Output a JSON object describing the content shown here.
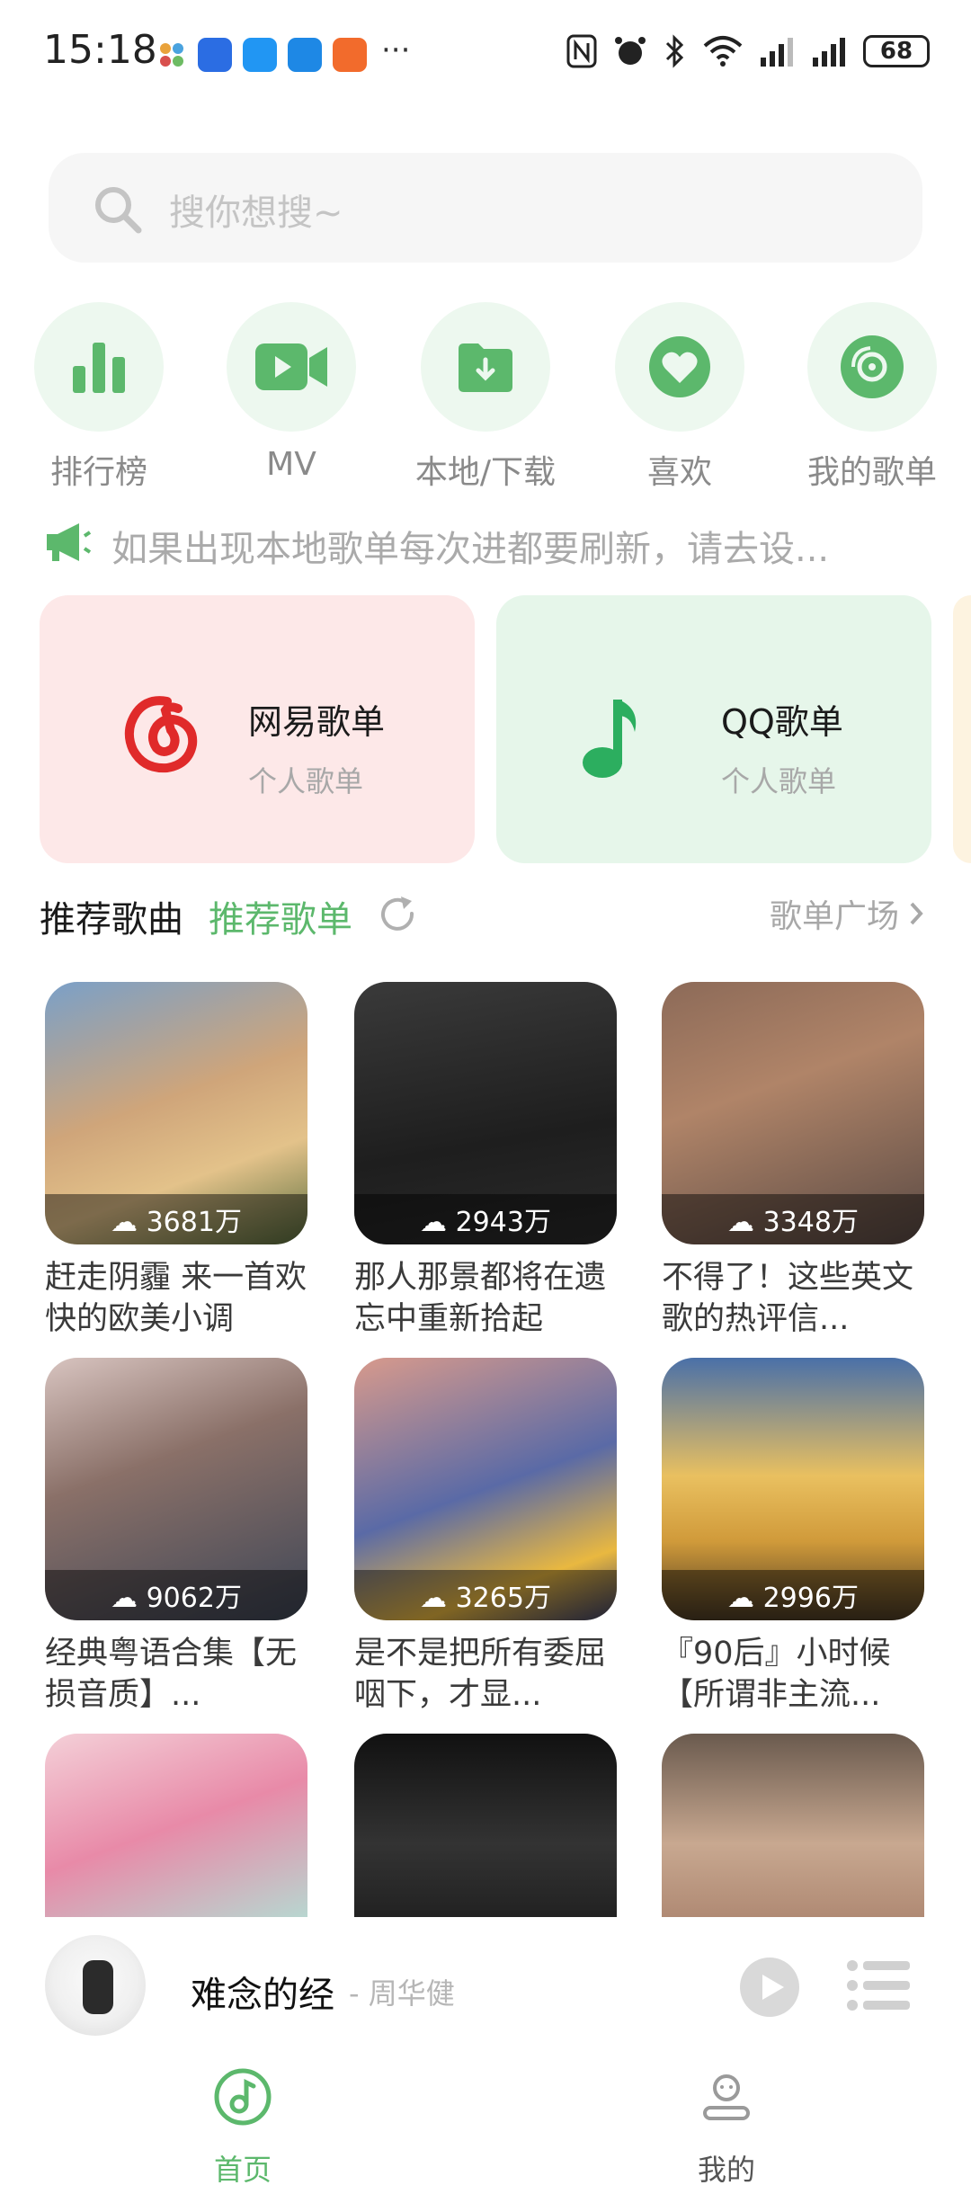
{
  "status_bar": {
    "time": "15:18",
    "battery": "68",
    "more": "···"
  },
  "search": {
    "placeholder": "搜你想搜~"
  },
  "categories": [
    {
      "label": "排行榜",
      "icon": "bar-chart-icon"
    },
    {
      "label": "MV",
      "icon": "video-camera-icon"
    },
    {
      "label": "本地/下载",
      "icon": "folder-download-icon"
    },
    {
      "label": "喜欢",
      "icon": "heart-icon"
    },
    {
      "label": "我的歌单",
      "icon": "disc-icon"
    }
  ],
  "notice": {
    "text": "如果出现本地歌单每次进都要刷新，请去设..."
  },
  "import_cards": [
    {
      "title": "网易歌单",
      "subtitle": "个人歌单",
      "color": "#fde8e8",
      "icon": "netease-cloud-music-icon"
    },
    {
      "title": "QQ歌单",
      "subtitle": "个人歌单",
      "color": "#e6f6ea",
      "icon": "qq-music-note-icon"
    }
  ],
  "section": {
    "tab_songs": "推荐歌曲",
    "tab_playlists": "推荐歌单",
    "plaza": "歌单广场"
  },
  "playlists": [
    {
      "count": "3681万",
      "title": "赶走阴霾 来一首欢快的欧美小调"
    },
    {
      "count": "2943万",
      "title": "那人那景都将在遗忘中重新拾起"
    },
    {
      "count": "3348万",
      "title": "不得了！这些英文歌的热评信..."
    },
    {
      "count": "9062万",
      "title": "经典粤语合集【无损音质】..."
    },
    {
      "count": "3265万",
      "title": "是不是把所有委屈咽下，才显..."
    },
    {
      "count": "2996万",
      "title": "『90后』小时候【所谓非主流..."
    },
    {
      "count": "",
      "title": ""
    },
    {
      "count": "",
      "title": ""
    },
    {
      "count": "",
      "title": ""
    }
  ],
  "now_playing": {
    "title": "难念的经",
    "artist": "- 周华健"
  },
  "bottom_nav": [
    {
      "label": "首页",
      "active": true
    },
    {
      "label": "我的",
      "active": false
    }
  ],
  "colors": {
    "accent": "#5cb86c",
    "accent_light": "#edf8ef"
  }
}
